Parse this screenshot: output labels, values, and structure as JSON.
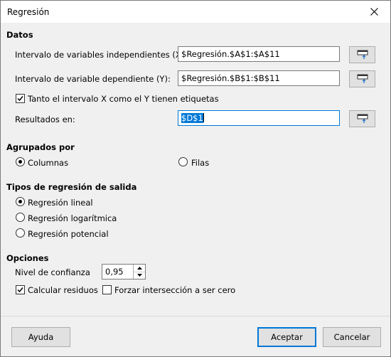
{
  "window": {
    "title": "Regresión"
  },
  "datos": {
    "heading": "Datos",
    "independent_label": "Intervalo de variables independientes (X):",
    "independent_value": "$Regresión.$A$1:$A$11",
    "dependent_label": "Intervalo de variable dependiente (Y):",
    "dependent_value": "$Regresión.$B$1:$B$11",
    "labels_checkbox": "Tanto el intervalo X como el Y tienen etiquetas",
    "labels_checked": true,
    "results_label": "Resultados en:",
    "results_value": "$D$1"
  },
  "agrupados": {
    "heading": "Agrupados por",
    "columns_label": "Columnas",
    "rows_label": "Filas",
    "selected": "Columnas"
  },
  "tipos": {
    "heading": "Tipos de regresión de salida",
    "linear_label": "Regresión lineal",
    "linear_checked": true,
    "log_label": "Regresión logarítmica",
    "log_checked": false,
    "power_label": "Regresión potencial",
    "power_checked": false
  },
  "opciones": {
    "heading": "Opciones",
    "confidence_label": "Nivel de confianza",
    "confidence_value": "0,95",
    "residuals_label": "Calcular residuos",
    "residuals_checked": true,
    "force_intercept_label": "Forzar intersección a ser cero",
    "force_intercept_checked": false
  },
  "buttons": {
    "help": "Ayuda",
    "ok": "Aceptar",
    "cancel": "Cancelar"
  },
  "icons": {
    "close": "close-icon",
    "shrink": "shrink-range-icon",
    "check": "checkmark-icon",
    "spin_up": "spin-up-icon",
    "spin_down": "spin-down-icon"
  },
  "colors": {
    "accent": "#0078d7",
    "dialog_bg": "#f0f0f0",
    "button_bg": "#e1e1e1"
  }
}
